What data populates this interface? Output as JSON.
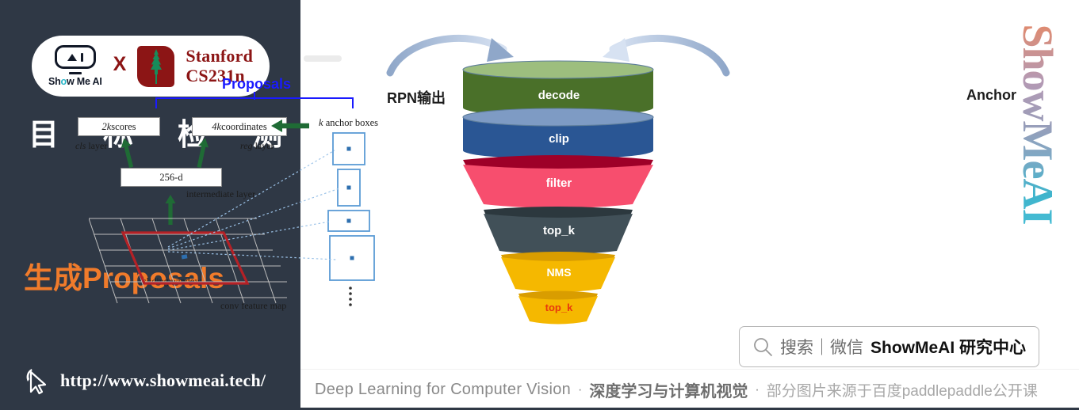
{
  "sidebar": {
    "brand": {
      "showmeai_word_pre": "Sh",
      "showmeai_word_eye": "o",
      "showmeai_word_post": "w Me AI",
      "cross": "X",
      "stanford_line1": "Stanford",
      "stanford_line2": "CS231n"
    },
    "title_chars": [
      "目",
      "标",
      "检",
      "测"
    ],
    "subtitle": "生成Proposals",
    "url": "http://www.showmeai.tech/",
    "accent_color": "#F07B2B",
    "background_color": "#2F3845"
  },
  "rpn_figure": {
    "proposals_label": "Proposals",
    "box_scores_prefix": "2k",
    "box_scores_suffix": " scores",
    "box_coords_prefix": "4k",
    "box_coords_suffix": " coordinates",
    "box_dim": "256-d",
    "cap_cls_italic": "cls",
    "cap_cls_rest": " layer",
    "cap_reg_italic": "reg",
    "cap_reg_rest": " layer",
    "cap_intermediate": "intermediate layer",
    "cap_sliding": "sliding window",
    "cap_conv": "conv feature map",
    "cap_anchor_italic": "k",
    "cap_anchor_rest": " anchor boxes",
    "arrow_color": "#1F6B35",
    "proposals_color": "#1A1AFF",
    "sliding_window_color": "#B42126",
    "anchor_box_color": "#5B9BD5"
  },
  "funnel": {
    "left_label": "RPN输出",
    "right_label": "Anchor",
    "stages": [
      {
        "name": "decode",
        "color": "#4A7029",
        "top_color": "#9DBE7E",
        "label_color": "#FFFFFF"
      },
      {
        "name": "clip",
        "color": "#2A5694",
        "top_color": "#7E9BC4",
        "label_color": "#FFFFFF"
      },
      {
        "name": "filter",
        "color": "#F74E6E",
        "top_color": "#9E0028",
        "label_color": "#FFFFFF"
      },
      {
        "name": "top_k",
        "color": "#415058",
        "top_color": "#2C383E",
        "label_color": "#FFFFFF"
      },
      {
        "name": "NMS",
        "color": "#F5B800",
        "top_color": "#D99D00",
        "label_color": "#FFFFFF"
      },
      {
        "name": "top_k",
        "color": "#F5B800",
        "top_color": "#D99D00",
        "label_color": "#E8380D"
      }
    ]
  },
  "watermark": {
    "text": "ShowMeAI"
  },
  "searchbar": {
    "icon": "search-icon",
    "prefix": "搜索｜微信",
    "brand": "ShowMeAI 研究中心"
  },
  "footer": {
    "english": "Deep Learning for Computer Vision",
    "sep1": "·",
    "chinese_bold": "深度学习与计算机视觉",
    "sep2": "·",
    "chinese_note": "部分图片来源于百度paddlepaddle公开课"
  }
}
